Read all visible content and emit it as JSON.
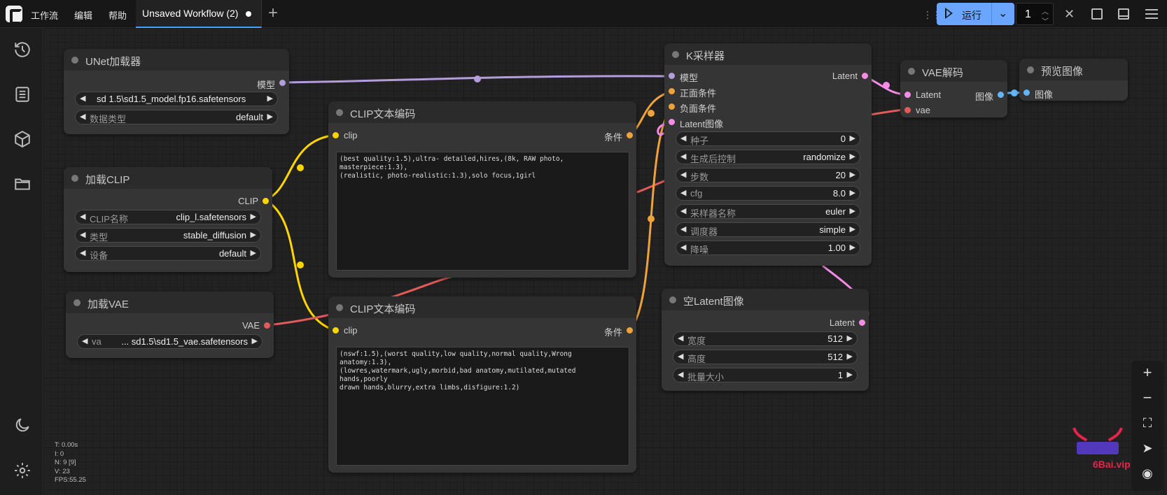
{
  "menu": [
    "工作流",
    "编辑",
    "帮助"
  ],
  "tab": {
    "label": "Unsaved Workflow (2)"
  },
  "run": {
    "label": "运行",
    "batch": "1"
  },
  "nodes": {
    "unet": {
      "title": "UNet加载器",
      "out": "模型",
      "w1": "sd 1.5\\sd1.5_model.fp16.safetensors",
      "w2_label": "数据类型",
      "w2_value": "default"
    },
    "clip_loader": {
      "title": "加载CLIP",
      "out": "CLIP",
      "widgets": [
        {
          "label": "CLIP名称",
          "value": "clip_l.safetensors"
        },
        {
          "label": "类型",
          "value": "stable_diffusion"
        },
        {
          "label": "设备",
          "value": "default"
        }
      ]
    },
    "vae_loader": {
      "title": "加载VAE",
      "out": "VAE",
      "w_label": "va",
      "w_value": "... sd1.5\\sd1.5_vae.safetensors"
    },
    "clip_pos": {
      "title": "CLIP文本编码",
      "in": "clip",
      "out": "条件",
      "text": "(best quality:1.5),ultra- detailed,hires,(8k, RAW photo, masterpiece:1.3),\n(realistic, photo-realistic:1.3),solo focus,1girl"
    },
    "clip_neg": {
      "title": "CLIP文本编码",
      "in": "clip",
      "out": "条件",
      "text": "(nswf:1.5),(worst quality,low quality,normal quality,Wrong anatomy:1.3),\n(lowres,watermark,ugly,morbid,bad anatomy,mutilated,mutated hands,poorly\ndrawn hands,blurry,extra limbs,disfigure:1.2)"
    },
    "ksampler": {
      "title": "K采样器",
      "inputs": [
        "模型",
        "正面条件",
        "负面条件",
        "Latent图像"
      ],
      "out": "Latent",
      "widgets": [
        {
          "label": "种子",
          "value": "0"
        },
        {
          "label": "生成后控制",
          "value": "randomize"
        },
        {
          "label": "步数",
          "value": "20"
        },
        {
          "label": "cfg",
          "value": "8.0"
        },
        {
          "label": "采样器名称",
          "value": "euler"
        },
        {
          "label": "调度器",
          "value": "simple"
        },
        {
          "label": "降噪",
          "value": "1.00"
        }
      ]
    },
    "empty_latent": {
      "title": "空Latent图像",
      "out": "Latent",
      "widgets": [
        {
          "label": "宽度",
          "value": "512"
        },
        {
          "label": "高度",
          "value": "512"
        },
        {
          "label": "批量大小",
          "value": "1"
        }
      ]
    },
    "vae_decode": {
      "title": "VAE解码",
      "in1": "Latent",
      "in2": "vae",
      "out": "图像"
    },
    "preview": {
      "title": "预览图像",
      "in": "图像"
    }
  },
  "stats": [
    "T: 0.00s",
    "I: 0",
    "N: 9 [9]",
    "V: 23",
    "FPS:55.25"
  ],
  "watermark": {
    "text": "6Bai.vip"
  }
}
